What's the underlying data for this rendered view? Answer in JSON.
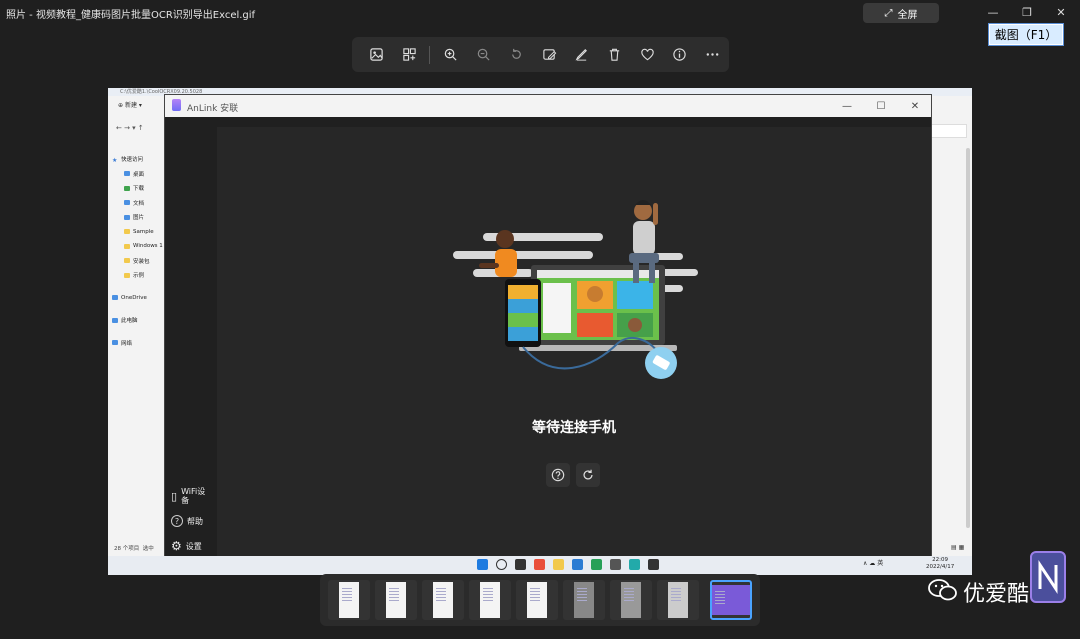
{
  "window": {
    "title": "照片 - 视频教程_健康码图片批量OCR识别导出Excel.gif",
    "fullscreen_label": "全屏",
    "minimize": "—",
    "restore": "❐",
    "close": "✕",
    "screenshot_hint": "截图（F1）"
  },
  "toolbar": {
    "icons": [
      "image-icon",
      "collection-icon",
      "zoom-in-icon",
      "zoom-out-icon",
      "rotate-icon",
      "edit-icon",
      "draw-icon",
      "delete-icon",
      "favorite-icon",
      "info-icon",
      "more-icon"
    ]
  },
  "explorer": {
    "path": "C:\\优爱酷1.\\CoolOCRX09.20.5028",
    "new_label": "新建",
    "sidebar": [
      {
        "label": "快速访问",
        "kind": "star"
      },
      {
        "label": "桌面",
        "kind": "blue"
      },
      {
        "label": "下载",
        "kind": "green"
      },
      {
        "label": "文档",
        "kind": "blue"
      },
      {
        "label": "图片",
        "kind": "blue"
      },
      {
        "label": "Sample",
        "kind": "folder"
      },
      {
        "label": "Windows 1",
        "kind": "folder"
      },
      {
        "label": "安装包",
        "kind": "folder"
      },
      {
        "label": "示例",
        "kind": "folder"
      },
      {
        "label": "OneDrive",
        "kind": "blue"
      },
      {
        "label": "此电脑",
        "kind": "blue"
      },
      {
        "label": "网络",
        "kind": "blue"
      }
    ],
    "status": "28 个项目",
    "status2": "选中"
  },
  "anlink": {
    "title": "AnLink 安联",
    "status": "等待连接手机",
    "sidebar": {
      "wifi": "WiFi设备",
      "help": "帮助",
      "settings": "设置"
    }
  },
  "taskbar": {
    "tray": "∧ ☁ 英",
    "time": "22:09",
    "date": "2022/4/17"
  },
  "watermark": {
    "text": "优爱酷"
  },
  "colors": {
    "accent": "#4aa3ff",
    "hint_bg": "#d9ecff"
  }
}
